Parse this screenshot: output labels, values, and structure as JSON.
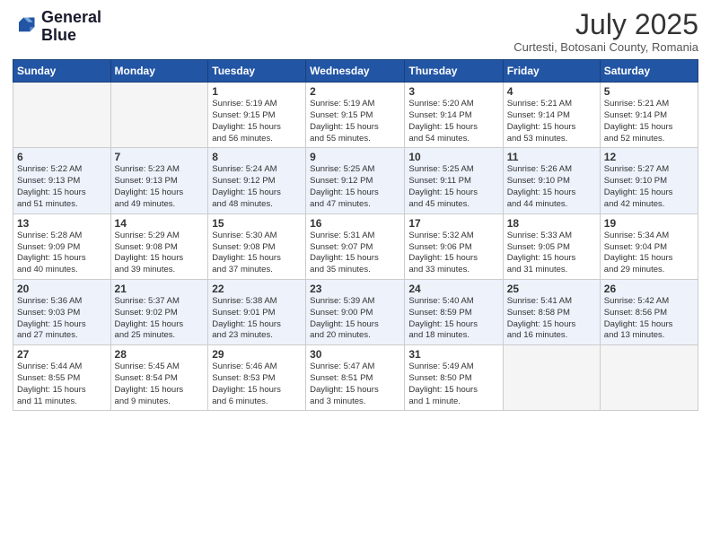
{
  "header": {
    "logo_line1": "General",
    "logo_line2": "Blue",
    "month": "July 2025",
    "location": "Curtesti, Botosani County, Romania"
  },
  "weekdays": [
    "Sunday",
    "Monday",
    "Tuesday",
    "Wednesday",
    "Thursday",
    "Friday",
    "Saturday"
  ],
  "weeks": [
    [
      {
        "day": "",
        "info": ""
      },
      {
        "day": "",
        "info": ""
      },
      {
        "day": "1",
        "info": "Sunrise: 5:19 AM\nSunset: 9:15 PM\nDaylight: 15 hours\nand 56 minutes."
      },
      {
        "day": "2",
        "info": "Sunrise: 5:19 AM\nSunset: 9:15 PM\nDaylight: 15 hours\nand 55 minutes."
      },
      {
        "day": "3",
        "info": "Sunrise: 5:20 AM\nSunset: 9:14 PM\nDaylight: 15 hours\nand 54 minutes."
      },
      {
        "day": "4",
        "info": "Sunrise: 5:21 AM\nSunset: 9:14 PM\nDaylight: 15 hours\nand 53 minutes."
      },
      {
        "day": "5",
        "info": "Sunrise: 5:21 AM\nSunset: 9:14 PM\nDaylight: 15 hours\nand 52 minutes."
      }
    ],
    [
      {
        "day": "6",
        "info": "Sunrise: 5:22 AM\nSunset: 9:13 PM\nDaylight: 15 hours\nand 51 minutes."
      },
      {
        "day": "7",
        "info": "Sunrise: 5:23 AM\nSunset: 9:13 PM\nDaylight: 15 hours\nand 49 minutes."
      },
      {
        "day": "8",
        "info": "Sunrise: 5:24 AM\nSunset: 9:12 PM\nDaylight: 15 hours\nand 48 minutes."
      },
      {
        "day": "9",
        "info": "Sunrise: 5:25 AM\nSunset: 9:12 PM\nDaylight: 15 hours\nand 47 minutes."
      },
      {
        "day": "10",
        "info": "Sunrise: 5:25 AM\nSunset: 9:11 PM\nDaylight: 15 hours\nand 45 minutes."
      },
      {
        "day": "11",
        "info": "Sunrise: 5:26 AM\nSunset: 9:10 PM\nDaylight: 15 hours\nand 44 minutes."
      },
      {
        "day": "12",
        "info": "Sunrise: 5:27 AM\nSunset: 9:10 PM\nDaylight: 15 hours\nand 42 minutes."
      }
    ],
    [
      {
        "day": "13",
        "info": "Sunrise: 5:28 AM\nSunset: 9:09 PM\nDaylight: 15 hours\nand 40 minutes."
      },
      {
        "day": "14",
        "info": "Sunrise: 5:29 AM\nSunset: 9:08 PM\nDaylight: 15 hours\nand 39 minutes."
      },
      {
        "day": "15",
        "info": "Sunrise: 5:30 AM\nSunset: 9:08 PM\nDaylight: 15 hours\nand 37 minutes."
      },
      {
        "day": "16",
        "info": "Sunrise: 5:31 AM\nSunset: 9:07 PM\nDaylight: 15 hours\nand 35 minutes."
      },
      {
        "day": "17",
        "info": "Sunrise: 5:32 AM\nSunset: 9:06 PM\nDaylight: 15 hours\nand 33 minutes."
      },
      {
        "day": "18",
        "info": "Sunrise: 5:33 AM\nSunset: 9:05 PM\nDaylight: 15 hours\nand 31 minutes."
      },
      {
        "day": "19",
        "info": "Sunrise: 5:34 AM\nSunset: 9:04 PM\nDaylight: 15 hours\nand 29 minutes."
      }
    ],
    [
      {
        "day": "20",
        "info": "Sunrise: 5:36 AM\nSunset: 9:03 PM\nDaylight: 15 hours\nand 27 minutes."
      },
      {
        "day": "21",
        "info": "Sunrise: 5:37 AM\nSunset: 9:02 PM\nDaylight: 15 hours\nand 25 minutes."
      },
      {
        "day": "22",
        "info": "Sunrise: 5:38 AM\nSunset: 9:01 PM\nDaylight: 15 hours\nand 23 minutes."
      },
      {
        "day": "23",
        "info": "Sunrise: 5:39 AM\nSunset: 9:00 PM\nDaylight: 15 hours\nand 20 minutes."
      },
      {
        "day": "24",
        "info": "Sunrise: 5:40 AM\nSunset: 8:59 PM\nDaylight: 15 hours\nand 18 minutes."
      },
      {
        "day": "25",
        "info": "Sunrise: 5:41 AM\nSunset: 8:58 PM\nDaylight: 15 hours\nand 16 minutes."
      },
      {
        "day": "26",
        "info": "Sunrise: 5:42 AM\nSunset: 8:56 PM\nDaylight: 15 hours\nand 13 minutes."
      }
    ],
    [
      {
        "day": "27",
        "info": "Sunrise: 5:44 AM\nSunset: 8:55 PM\nDaylight: 15 hours\nand 11 minutes."
      },
      {
        "day": "28",
        "info": "Sunrise: 5:45 AM\nSunset: 8:54 PM\nDaylight: 15 hours\nand 9 minutes."
      },
      {
        "day": "29",
        "info": "Sunrise: 5:46 AM\nSunset: 8:53 PM\nDaylight: 15 hours\nand 6 minutes."
      },
      {
        "day": "30",
        "info": "Sunrise: 5:47 AM\nSunset: 8:51 PM\nDaylight: 15 hours\nand 3 minutes."
      },
      {
        "day": "31",
        "info": "Sunrise: 5:49 AM\nSunset: 8:50 PM\nDaylight: 15 hours\nand 1 minute."
      },
      {
        "day": "",
        "info": ""
      },
      {
        "day": "",
        "info": ""
      }
    ]
  ]
}
